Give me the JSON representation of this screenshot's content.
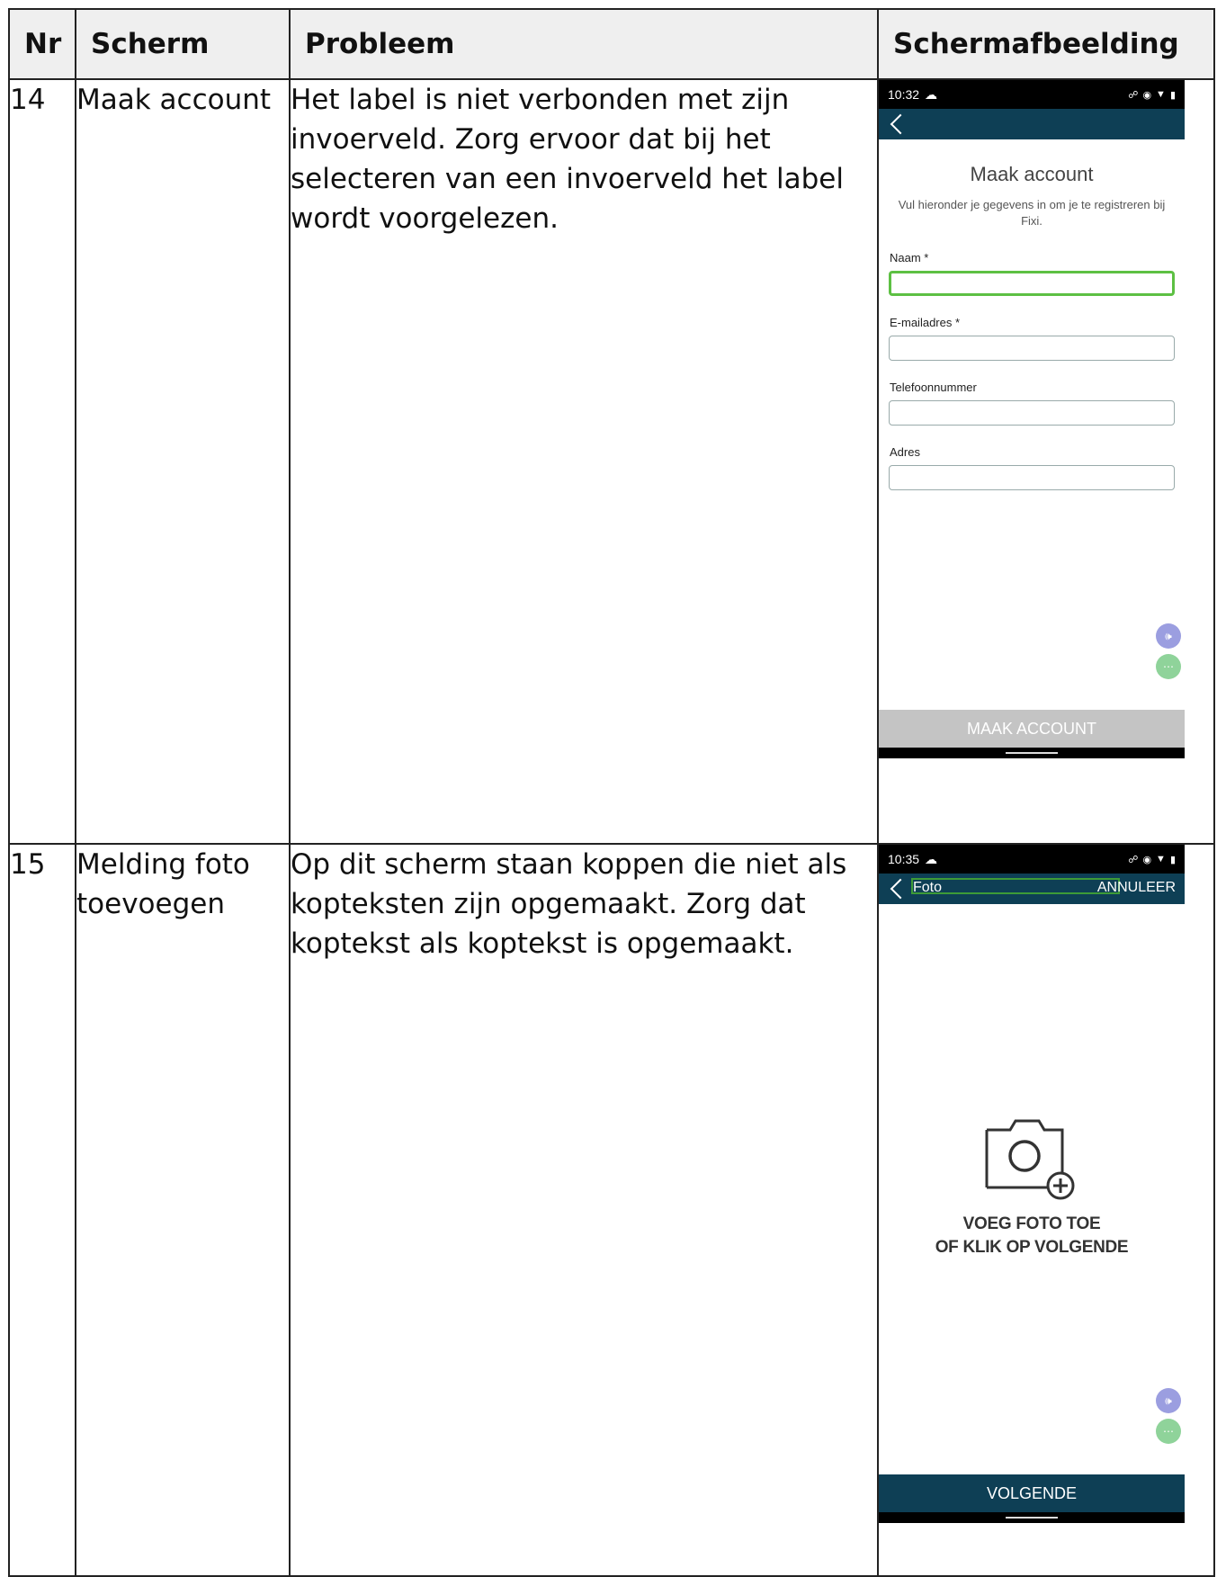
{
  "table": {
    "headers": [
      "Nr",
      "Scherm",
      "Probleem",
      "Schermafbeelding"
    ],
    "rows": [
      {
        "nr": "14",
        "scherm": "Maak account",
        "probleem": "Het label is niet verbonden met zijn invoerveld. Zorg ervoor dat bij het selecteren van een invoerveld het label wordt voorgelezen."
      },
      {
        "nr": "15",
        "scherm": "Melding foto toevoegen",
        "probleem": "Op dit scherm staan koppen die niet als kopteksten zijn opgemaakt. Zorg dat koptekst als koptekst is opgemaakt."
      }
    ]
  },
  "screen14": {
    "time": "10:32",
    "title": "Maak account",
    "subtitle": "Vul hieronder je gegevens in om je te registreren bij Fixi.",
    "fields": [
      "Naam *",
      "E-mailadres *",
      "Telefoonnummer",
      "Adres"
    ],
    "button": "MAAK ACCOUNT",
    "button_color": "#c4c4c4"
  },
  "screen15": {
    "time": "10:35",
    "appbar_title": "Foto",
    "appbar_action": "ANNULEER",
    "camera_text_line1": "VOEG FOTO TOE",
    "camera_text_line2": "OF KLIK OP VOLGENDE",
    "button": "VOLGENDE",
    "button_color": "#0e3f55"
  },
  "colors": {
    "header_bg": "#efefef",
    "appbar": "#0e3f55",
    "focus_green": "#5dc043"
  }
}
